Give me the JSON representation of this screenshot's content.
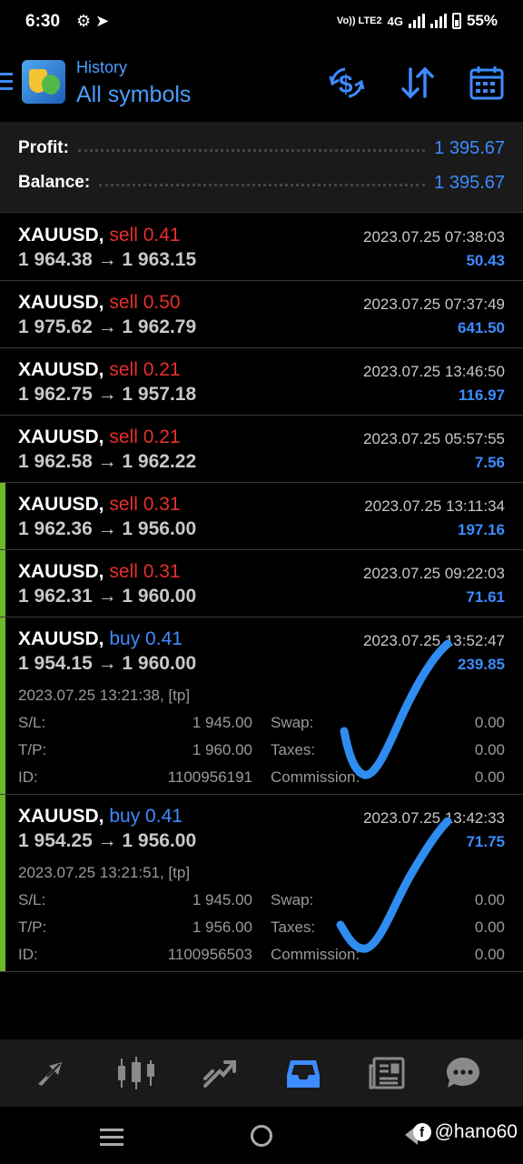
{
  "status": {
    "time": "6:30",
    "network": "4G",
    "volte": "Vo)) LTE2",
    "battery": "55%"
  },
  "header": {
    "section": "History",
    "title": "All symbols",
    "icons": [
      "dollar-exchange-icon",
      "sort-icon",
      "calendar-icon"
    ]
  },
  "summary": {
    "profit_label": "Profit:",
    "profit_value": "1 395.67",
    "balance_label": "Balance:",
    "balance_value": "1 395.67"
  },
  "trades": [
    {
      "symbol": "XAUUSD,",
      "type": "sell 0.41",
      "prices": "1 964.38 → 1 963.15",
      "time": "2023.07.25 07:38:03",
      "profit": "50.43"
    },
    {
      "symbol": "XAUUSD,",
      "type": "sell 0.50",
      "prices": "1 975.62 → 1 962.79",
      "time": "2023.07.25 07:37:49",
      "profit": "641.50"
    },
    {
      "symbol": "XAUUSD,",
      "type": "sell 0.21",
      "prices": "1 962.75 → 1 957.18",
      "time": "2023.07.25 13:46:50",
      "profit": "116.97"
    },
    {
      "symbol": "XAUUSD,",
      "type": "sell 0.21",
      "prices": "1 962.58 → 1 962.22",
      "time": "2023.07.25 05:57:55",
      "profit": "7.56"
    },
    {
      "symbol": "XAUUSD,",
      "type": "sell 0.31",
      "prices": "1 962.36 → 1 956.00",
      "time": "2023.07.25 13:11:34",
      "profit": "197.16"
    },
    {
      "symbol": "XAUUSD,",
      "type": "sell 0.31",
      "prices": "1 962.31 → 1 960.00",
      "time": "2023.07.25 09:22:03",
      "profit": "71.61"
    },
    {
      "symbol": "XAUUSD,",
      "type": "buy 0.41",
      "prices": "1 954.15 → 1 960.00",
      "time": "2023.07.25 13:52:47",
      "profit": "239.85",
      "open_time": "2023.07.25 13:21:38, [tp]",
      "sl_label": "S/L:",
      "sl": "1 945.00",
      "tp_label": "T/P:",
      "tp": "1 960.00",
      "id_label": "ID:",
      "id": "1100956191",
      "swap_label": "Swap:",
      "swap": "0.00",
      "taxes_label": "Taxes:",
      "taxes": "0.00",
      "commission_label": "Commission:",
      "commission": "0.00"
    },
    {
      "symbol": "XAUUSD,",
      "type": "buy 0.41",
      "prices": "1 954.25 → 1 956.00",
      "time": "2023.07.25 13:42:33",
      "profit": "71.75",
      "open_time": "2023.07.25 13:21:51, [tp]",
      "sl_label": "S/L:",
      "sl": "1 945.00",
      "tp_label": "T/P:",
      "tp": "1 956.00",
      "id_label": "ID:",
      "id": "1100956503",
      "swap_label": "Swap:",
      "swap": "0.00",
      "taxes_label": "Taxes:",
      "taxes": "0.00",
      "commission_label": "Commission:",
      "commission": "0.00"
    }
  ],
  "tabs": [
    "quotes-icon",
    "chart-icon",
    "trade-icon",
    "history-icon",
    "news-icon",
    "chat-icon"
  ],
  "active_tab": "history-icon",
  "watermark": "@hano60",
  "colors": {
    "accent": "#3d8bff",
    "sell": "#e8302c",
    "highlight_bar": "#6bb82a"
  }
}
